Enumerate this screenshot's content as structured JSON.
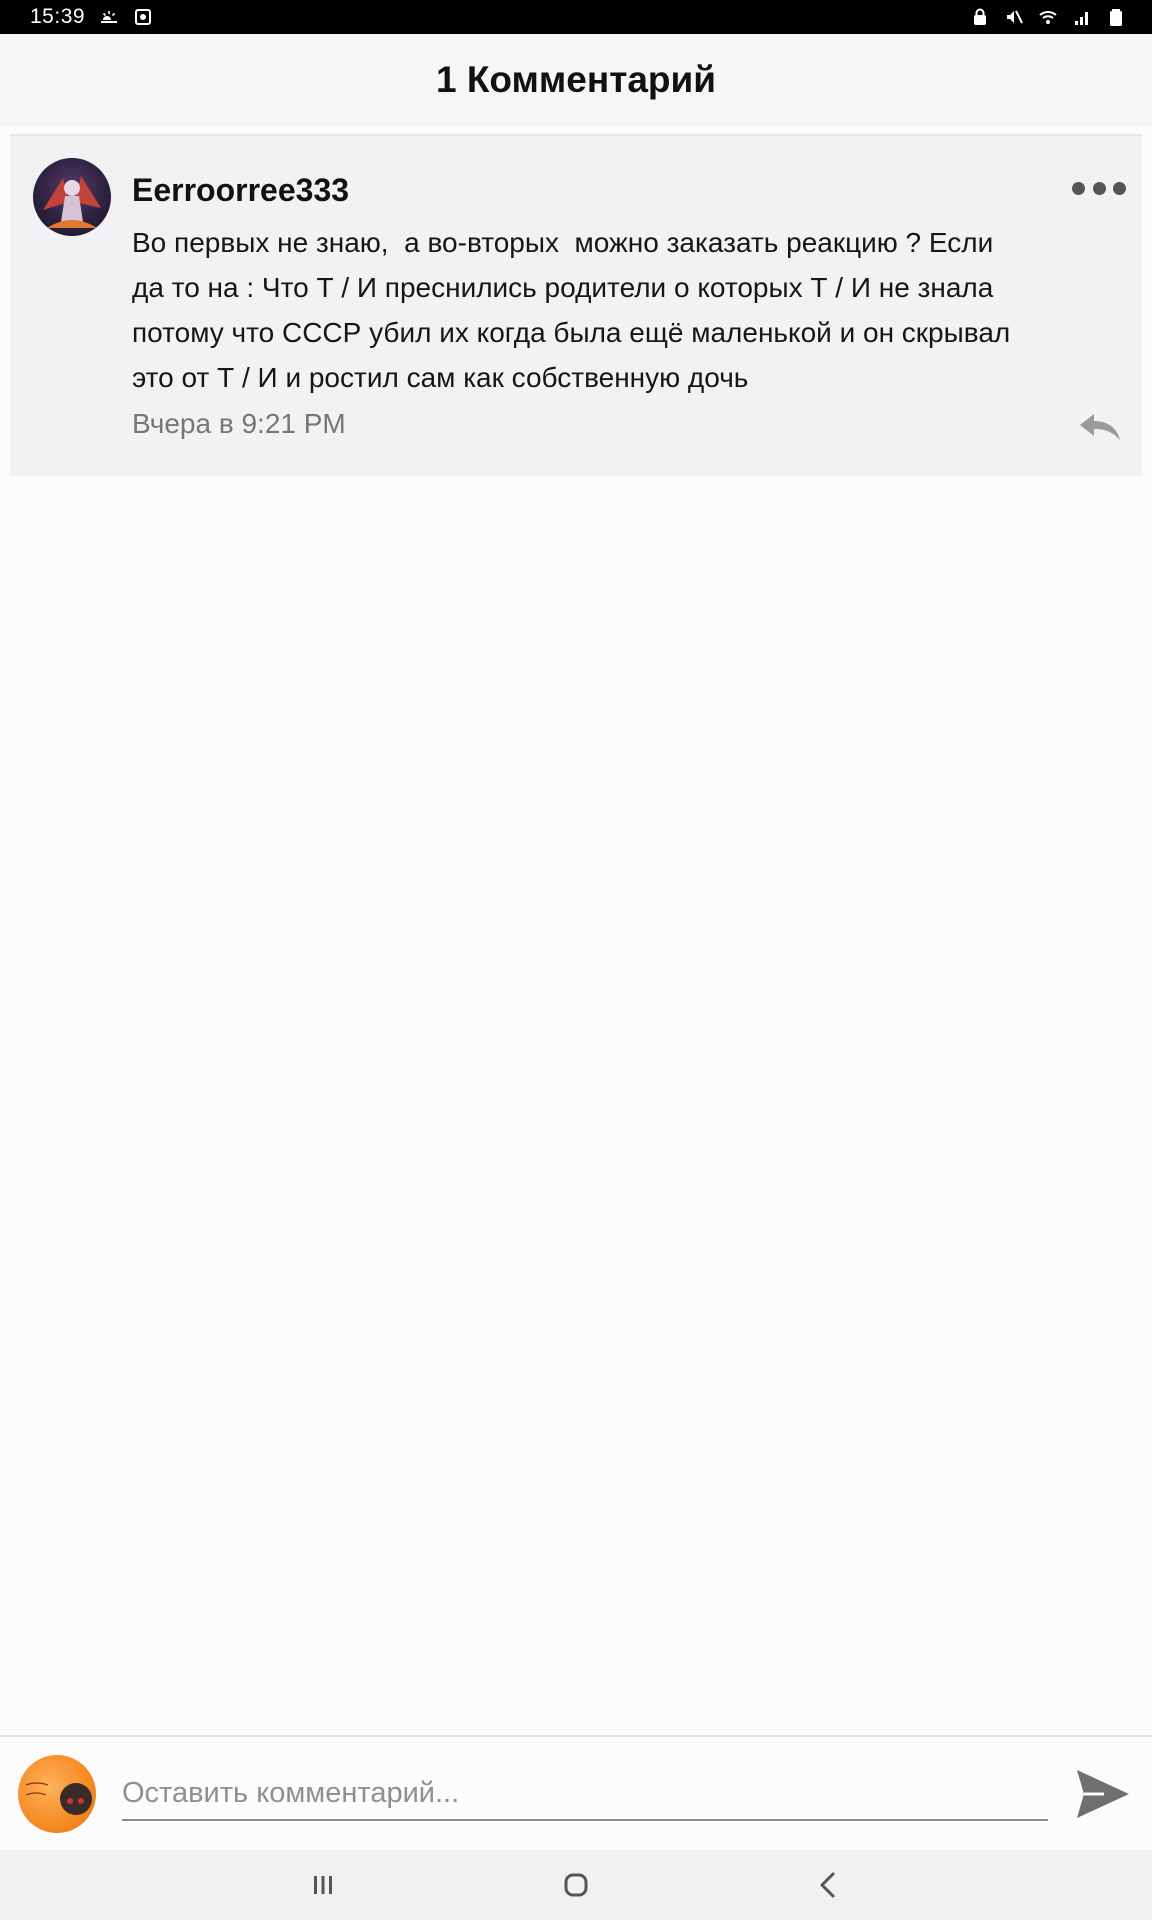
{
  "status_bar": {
    "time": "15:39",
    "icons": [
      "weather-icon",
      "screenshot-icon",
      "lock-icon",
      "mute-icon",
      "wifi-icon",
      "signal-icon",
      "battery-icon"
    ]
  },
  "header": {
    "title": "1 Комментарий"
  },
  "comment": {
    "author": "Eerroorree333",
    "text": "Во первых не знаю,  а во-вторых  можно заказать реакцию ? Если\nда то на : Что Т / И преснились родители о которых Т / И не знала\nпотому что СССР убил их когда была ещё маленькой и он скрывал\nэто от Т / И и ростил сам как собственную дочь",
    "time": "Вчера в 9:21 PM",
    "more_icon": "more-dots-icon",
    "reply_icon": "reply-icon"
  },
  "composer": {
    "placeholder": "Оставить комментарий...",
    "value": "",
    "send_icon": "send-icon"
  },
  "nav_bar": {
    "recents_icon": "recents-icon",
    "home_icon": "home-icon",
    "back_icon": "back-icon"
  },
  "colors": {
    "card_background": "#f2f1f3",
    "meta_text": "#777777",
    "icon_gray": "#555555"
  }
}
